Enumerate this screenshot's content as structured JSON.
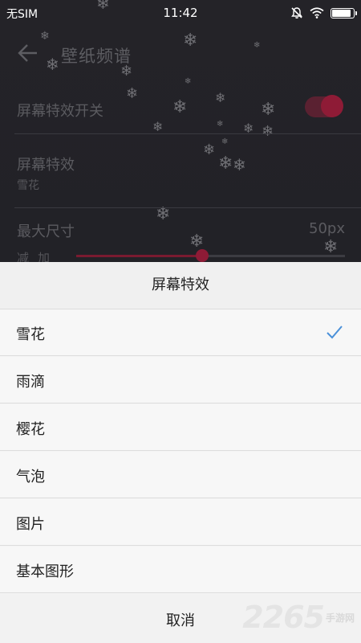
{
  "status_bar": {
    "carrier": "无SIM",
    "time": "11:42",
    "battery_level": 0.9
  },
  "header": {
    "title": "壁纸频谱",
    "back_icon": "arrow-left-icon"
  },
  "settings": {
    "effect_toggle_label": "屏幕特效开关",
    "effect_toggle_on": true,
    "effect_label": "屏幕特效",
    "effect_value": "雪花",
    "max_size_label": "最大尺寸",
    "max_size_value": "50px",
    "slider_minus": "减",
    "slider_plus": "加",
    "slider_level": 0.47
  },
  "sheet": {
    "title": "屏幕特效",
    "options": [
      {
        "label": "雪花",
        "selected": true
      },
      {
        "label": "雨滴",
        "selected": false
      },
      {
        "label": "樱花",
        "selected": false
      },
      {
        "label": "气泡",
        "selected": false
      },
      {
        "label": "图片",
        "selected": false
      },
      {
        "label": "基本图形",
        "selected": false
      }
    ],
    "cancel_label": "取消"
  },
  "watermark": {
    "number": "2265",
    "sub": "手游网"
  },
  "colors": {
    "accent": "#8e1b36",
    "check": "#4a90d9"
  }
}
